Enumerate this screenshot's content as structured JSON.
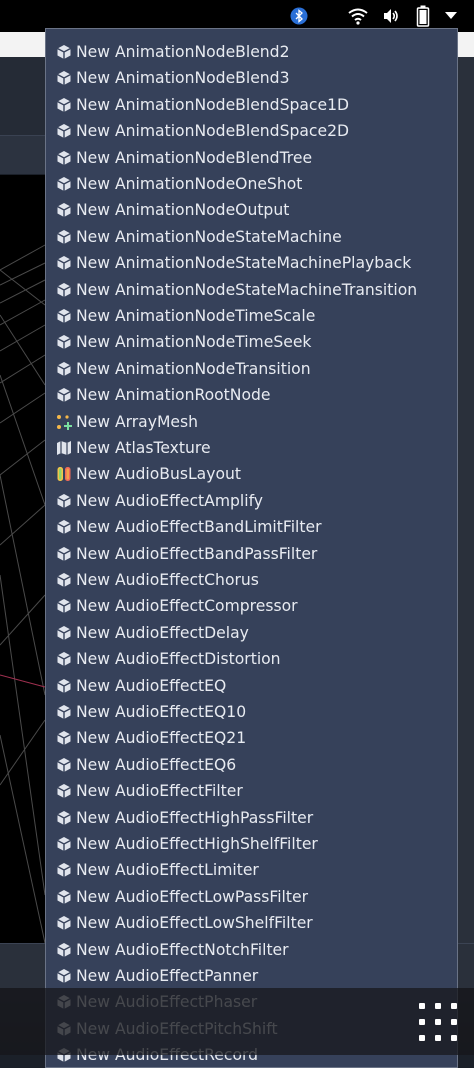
{
  "status_bar": {
    "icons": [
      "bluetooth-icon",
      "wifi-icon",
      "volume-icon",
      "battery-icon",
      "dropdown-arrow-icon"
    ]
  },
  "menu": {
    "items": [
      {
        "label": "New AnimationNodeBlend2",
        "icon": "cube-icon"
      },
      {
        "label": "New AnimationNodeBlend3",
        "icon": "cube-icon"
      },
      {
        "label": "New AnimationNodeBlendSpace1D",
        "icon": "cube-icon"
      },
      {
        "label": "New AnimationNodeBlendSpace2D",
        "icon": "cube-icon"
      },
      {
        "label": "New AnimationNodeBlendTree",
        "icon": "cube-icon"
      },
      {
        "label": "New AnimationNodeOneShot",
        "icon": "cube-icon"
      },
      {
        "label": "New AnimationNodeOutput",
        "icon": "cube-icon"
      },
      {
        "label": "New AnimationNodeStateMachine",
        "icon": "cube-icon"
      },
      {
        "label": "New AnimationNodeStateMachinePlayback",
        "icon": "cube-icon"
      },
      {
        "label": "New AnimationNodeStateMachineTransition",
        "icon": "cube-icon"
      },
      {
        "label": "New AnimationNodeTimeScale",
        "icon": "cube-icon"
      },
      {
        "label": "New AnimationNodeTimeSeek",
        "icon": "cube-icon"
      },
      {
        "label": "New AnimationNodeTransition",
        "icon": "cube-icon"
      },
      {
        "label": "New AnimationRootNode",
        "icon": "cube-icon"
      },
      {
        "label": "New ArrayMesh",
        "icon": "array-mesh-icon"
      },
      {
        "label": "New AtlasTexture",
        "icon": "atlas-texture-icon"
      },
      {
        "label": "New AudioBusLayout",
        "icon": "audio-bus-layout-icon"
      },
      {
        "label": "New AudioEffectAmplify",
        "icon": "cube-icon"
      },
      {
        "label": "New AudioEffectBandLimitFilter",
        "icon": "cube-icon"
      },
      {
        "label": "New AudioEffectBandPassFilter",
        "icon": "cube-icon"
      },
      {
        "label": "New AudioEffectChorus",
        "icon": "cube-icon"
      },
      {
        "label": "New AudioEffectCompressor",
        "icon": "cube-icon"
      },
      {
        "label": "New AudioEffectDelay",
        "icon": "cube-icon"
      },
      {
        "label": "New AudioEffectDistortion",
        "icon": "cube-icon"
      },
      {
        "label": "New AudioEffectEQ",
        "icon": "cube-icon"
      },
      {
        "label": "New AudioEffectEQ10",
        "icon": "cube-icon"
      },
      {
        "label": "New AudioEffectEQ21",
        "icon": "cube-icon"
      },
      {
        "label": "New AudioEffectEQ6",
        "icon": "cube-icon"
      },
      {
        "label": "New AudioEffectFilter",
        "icon": "cube-icon"
      },
      {
        "label": "New AudioEffectHighPassFilter",
        "icon": "cube-icon"
      },
      {
        "label": "New AudioEffectHighShelfFilter",
        "icon": "cube-icon"
      },
      {
        "label": "New AudioEffectLimiter",
        "icon": "cube-icon"
      },
      {
        "label": "New AudioEffectLowPassFilter",
        "icon": "cube-icon"
      },
      {
        "label": "New AudioEffectLowShelfFilter",
        "icon": "cube-icon"
      },
      {
        "label": "New AudioEffectNotchFilter",
        "icon": "cube-icon"
      },
      {
        "label": "New AudioEffectPanner",
        "icon": "cube-icon"
      },
      {
        "label": "New AudioEffectPhaser",
        "icon": "cube-icon"
      },
      {
        "label": "New AudioEffectPitchShift",
        "icon": "cube-icon"
      },
      {
        "label": "New AudioEffectRecord",
        "icon": "cube-icon"
      }
    ]
  },
  "nav": {
    "app_grid_icon": "app-grid-icon"
  }
}
